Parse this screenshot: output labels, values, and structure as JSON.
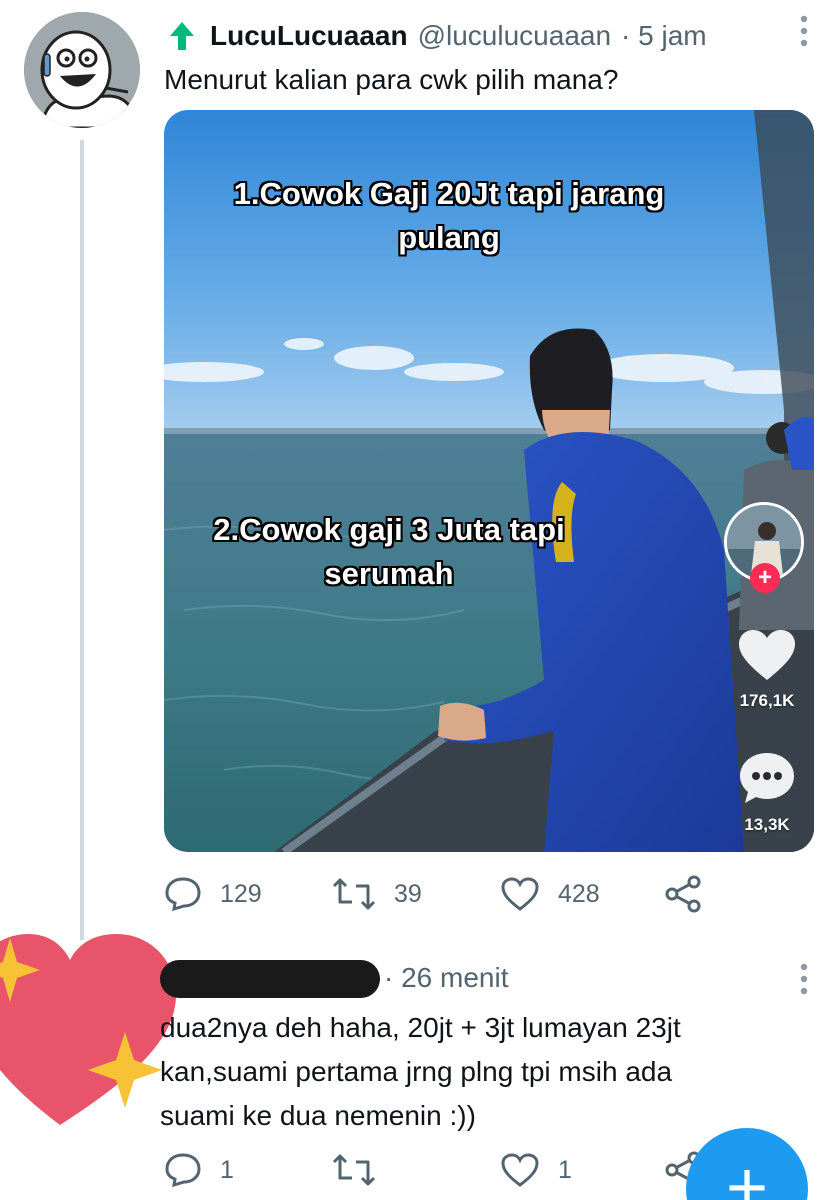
{
  "tweet": {
    "display_name": "LucuLucuaaan",
    "handle": "@luculucuaaan",
    "time": "· 5 jam",
    "text": "Menurut kalian para cwk pilih mana?",
    "media": {
      "caption_1_line1": "1.Cowok Gaji 20Jt tapi jarang",
      "caption_1_line2": "pulang",
      "caption_2_line1": "2.Cowok gaji 3 Juta tapi",
      "caption_2_line2": "serumah",
      "likes": "176,1K",
      "comments": "13,3K"
    },
    "actions": {
      "replies": "129",
      "retweets": "39",
      "likes": "428"
    }
  },
  "reply": {
    "time": "· 26 menit",
    "lines": [
      "dua2nya deh haha, 20jt + 3jt lumayan 23jt",
      "kan,suami pertama jrng plng tpi msih ada",
      "suami ke dua nemenin :))"
    ],
    "actions": {
      "replies": "1",
      "likes": "1"
    }
  },
  "fab": {
    "label": "+"
  },
  "colors": {
    "accent": "#1d9bf0",
    "secondary_text": "#536471",
    "heart_sticker": "#e8556a",
    "sparkle": "#f7c236"
  }
}
